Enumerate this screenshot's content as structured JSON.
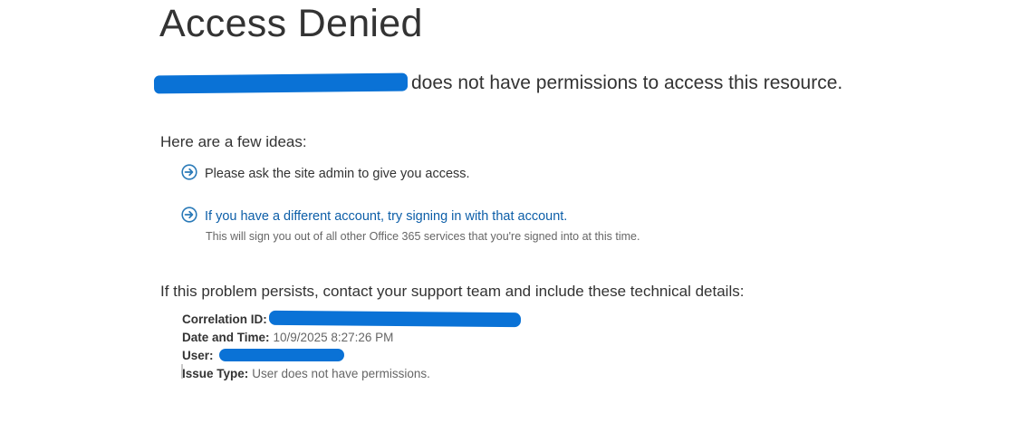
{
  "title": "Access Denied",
  "subtitle": "does not have permissions to access this resource.",
  "ideas_heading": "Here are a few ideas:",
  "ideas": [
    {
      "text": "Please ask the site admin to give you access."
    },
    {
      "text": "If you have a different account, try signing in with that account.",
      "subtext": "This will sign you out of all other Office 365 services that you're signed into at this time."
    }
  ],
  "persist_text": "If this problem persists, contact your support team and include these technical details:",
  "details": {
    "correlation_label": "Correlation ID:",
    "datetime_label": "Date and Time:",
    "datetime_value": "10/9/2025 8:27:26 PM",
    "user_label": "User:",
    "issue_label": "Issue Type:",
    "issue_value": "User does not have permissions."
  },
  "colors": {
    "redaction": "#0a72d6",
    "link": "#0c5ea8",
    "icon": "#2a7ab8"
  },
  "icons": {
    "idea_bullet": "circle-arrow-right-icon"
  }
}
